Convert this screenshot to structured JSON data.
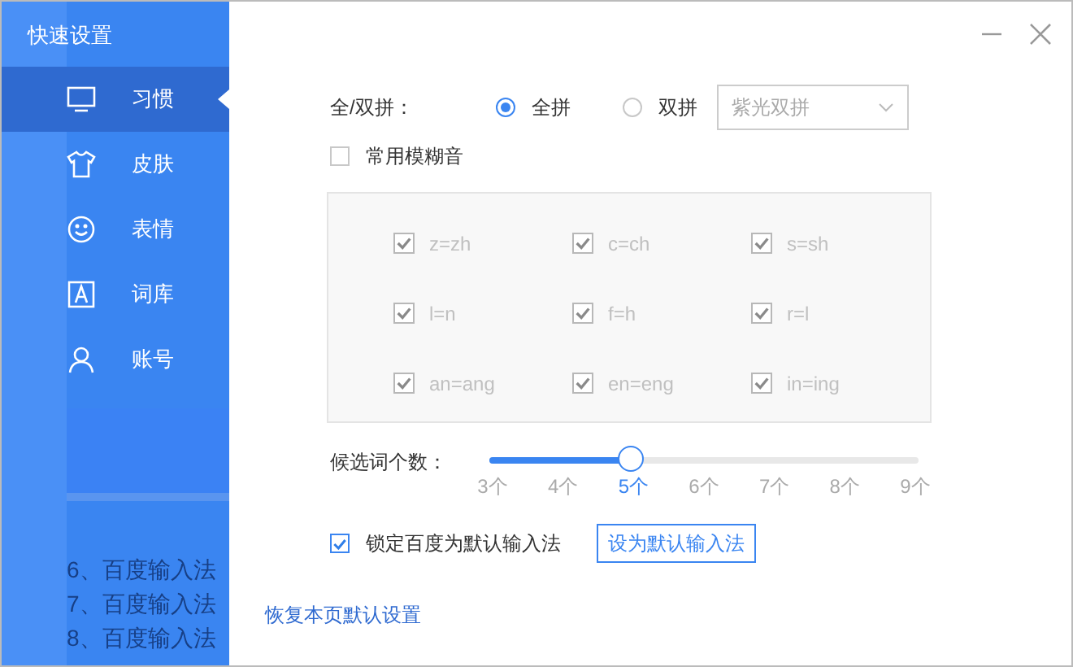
{
  "window": {
    "title": "快速设置"
  },
  "sidebar": {
    "items": [
      {
        "label": "习惯",
        "kind": "monitor",
        "selected": true
      },
      {
        "label": "皮肤",
        "kind": "shirt",
        "selected": false
      },
      {
        "label": "表情",
        "kind": "smile",
        "selected": false
      },
      {
        "label": "词库",
        "kind": "letter",
        "selected": false
      },
      {
        "label": "账号",
        "kind": "person",
        "selected": false
      }
    ],
    "background_lines": [
      "6、百度输入法",
      "7、百度输入法",
      "8、百度输入法"
    ]
  },
  "pinyin_mode": {
    "label": "全/双拼：",
    "options": [
      {
        "label": "全拼",
        "selected": true
      },
      {
        "label": "双拼",
        "selected": false
      }
    ],
    "dropdown": {
      "value": "紫光双拼",
      "disabled": true
    }
  },
  "fuzzy": {
    "label": "常用模糊音",
    "checked": false,
    "items": [
      {
        "label": "z=zh",
        "checked": true
      },
      {
        "label": "c=ch",
        "checked": true
      },
      {
        "label": "s=sh",
        "checked": true
      },
      {
        "label": "l=n",
        "checked": true
      },
      {
        "label": "f=h",
        "checked": true
      },
      {
        "label": "r=l",
        "checked": true
      },
      {
        "label": "an=ang",
        "checked": true
      },
      {
        "label": "en=eng",
        "checked": true
      },
      {
        "label": "in=ing",
        "checked": true
      }
    ]
  },
  "candidates": {
    "label": "候选词个数：",
    "level": 0.33,
    "ticks": [
      {
        "label": "3个",
        "selected": false
      },
      {
        "label": "4个",
        "selected": false
      },
      {
        "label": "5个",
        "selected": true
      },
      {
        "label": "6个",
        "selected": false
      },
      {
        "label": "7个",
        "selected": false
      },
      {
        "label": "8个",
        "selected": false
      },
      {
        "label": "9个",
        "selected": false
      }
    ]
  },
  "lock_default": {
    "label": "锁定百度为默认输入法",
    "checked": true
  },
  "set_default_button": "设为默认输入法",
  "restore_link": "恢复本页默认设置"
}
